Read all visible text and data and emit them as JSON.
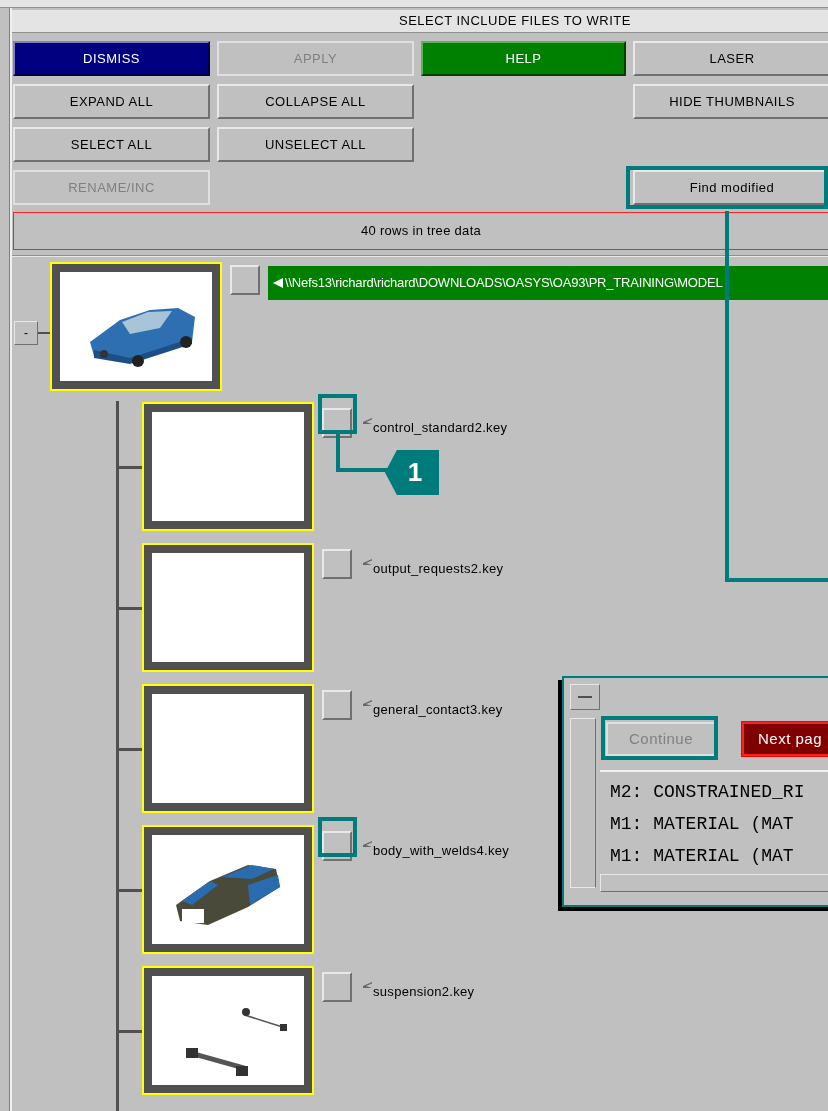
{
  "window": {
    "title": "SELECT INCLUDE FILES TO WRITE"
  },
  "buttons": [
    {
      "label": "DISMISS",
      "kind": "dismiss",
      "disabled": false,
      "highlighted": false
    },
    {
      "label": "APPLY",
      "kind": "normal",
      "disabled": true,
      "highlighted": false
    },
    {
      "label": "HELP",
      "kind": "help",
      "disabled": false,
      "highlighted": false
    },
    {
      "label": "LASER",
      "kind": "normal",
      "disabled": false,
      "highlighted": false
    },
    {
      "label": "EXPAND ALL",
      "kind": "normal",
      "disabled": false,
      "highlighted": false
    },
    {
      "label": "COLLAPSE ALL",
      "kind": "normal",
      "disabled": false,
      "highlighted": false
    },
    {
      "label": "HIDE THUMBNAILS",
      "kind": "normal",
      "disabled": false,
      "highlighted": false
    },
    {
      "label": "SELECT ALL",
      "kind": "normal",
      "disabled": false,
      "highlighted": false
    },
    {
      "label": "UNSELECT ALL",
      "kind": "normal",
      "disabled": false,
      "highlighted": false
    },
    {
      "label": "RENAME/INC",
      "kind": "normal",
      "disabled": true,
      "highlighted": false
    },
    {
      "label": "Find modified",
      "kind": "normal",
      "disabled": false,
      "highlighted": true
    }
  ],
  "status": "40 rows in tree data",
  "tree": {
    "toggle": "-",
    "expanded": true,
    "checked": false,
    "kind": "picture",
    "path": "\\\\Nefs13\\richard\\richard\\DOWNLOADS\\OASYS\\OA93\\PR_TRAINING\\MODEL",
    "children": [
      {
        "name": "control_standard2.key",
        "checked": false,
        "highlighted": true,
        "kind": "blank"
      },
      {
        "name": "output_requests2.key",
        "checked": false,
        "highlighted": false,
        "kind": "blank"
      },
      {
        "name": "general_contact3.key",
        "checked": false,
        "highlighted": false,
        "kind": "blank"
      },
      {
        "name": "body_with_welds4.key",
        "checked": false,
        "highlighted": true,
        "kind": "picture"
      },
      {
        "name": "suspension2.key",
        "checked": false,
        "highlighted": false,
        "kind": "picture"
      }
    ]
  },
  "popup": {
    "buttons": [
      {
        "label": "Continue",
        "kind": "normal",
        "disabled": true,
        "highlighted": true
      },
      {
        "label": "Next pag",
        "kind": "next",
        "disabled": false,
        "highlighted": false
      }
    ],
    "lines": [
      "M2: CONSTRAINED_RI",
      "M1: MATERIAL (MAT",
      "M1: MATERIAL (MAT"
    ]
  },
  "annotations": {
    "callout": "1"
  }
}
